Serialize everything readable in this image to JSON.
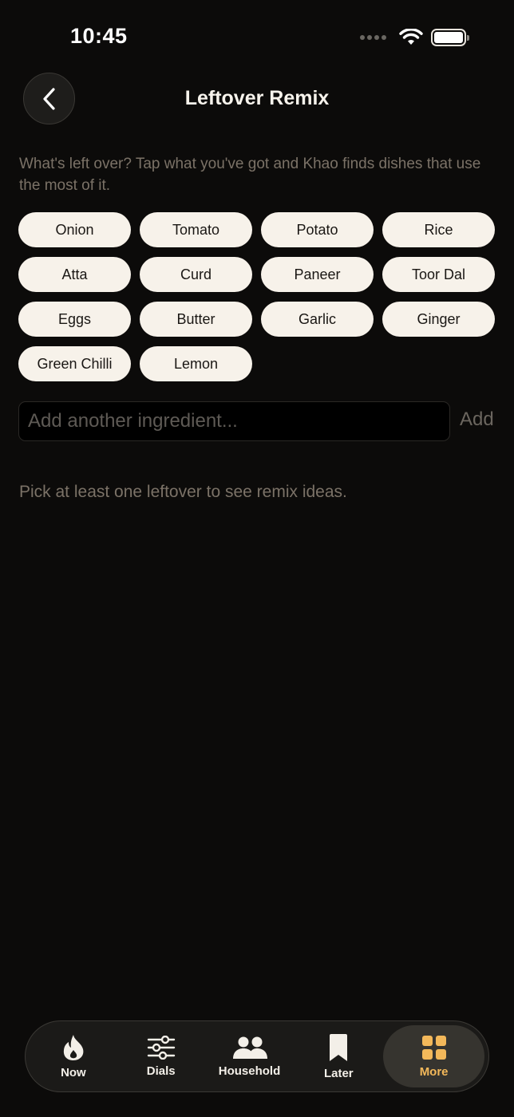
{
  "status_bar": {
    "time": "10:45"
  },
  "header": {
    "title": "Leftover Remix",
    "back_icon": "chevron-left-icon"
  },
  "intro_text": "What's left over? Tap what you've got and Khao finds dishes that use the most of it.",
  "ingredients": [
    {
      "label": "Onion"
    },
    {
      "label": "Tomato"
    },
    {
      "label": "Potato"
    },
    {
      "label": "Rice"
    },
    {
      "label": "Atta"
    },
    {
      "label": "Curd"
    },
    {
      "label": "Paneer"
    },
    {
      "label": "Toor Dal"
    },
    {
      "label": "Eggs"
    },
    {
      "label": "Butter"
    },
    {
      "label": "Garlic"
    },
    {
      "label": "Ginger"
    },
    {
      "label": "Green Chilli"
    },
    {
      "label": "Lemon"
    }
  ],
  "add_ingredient": {
    "placeholder": "Add another ingredient...",
    "value": "",
    "button_label": "Add"
  },
  "empty_hint": "Pick at least one leftover to see remix ideas.",
  "tabbar": {
    "tabs": [
      {
        "label": "Now",
        "icon": "flame-icon",
        "active": false
      },
      {
        "label": "Dials",
        "icon": "sliders-icon",
        "active": false
      },
      {
        "label": "Household",
        "icon": "people-icon",
        "active": false
      },
      {
        "label": "Later",
        "icon": "bookmark-icon",
        "active": false
      },
      {
        "label": "More",
        "icon": "grid-icon",
        "active": true
      }
    ]
  },
  "colors": {
    "background": "#0c0b0a",
    "chip_background": "#f7f2ea",
    "accent": "#f3b85a",
    "muted_text": "#7b7267"
  }
}
